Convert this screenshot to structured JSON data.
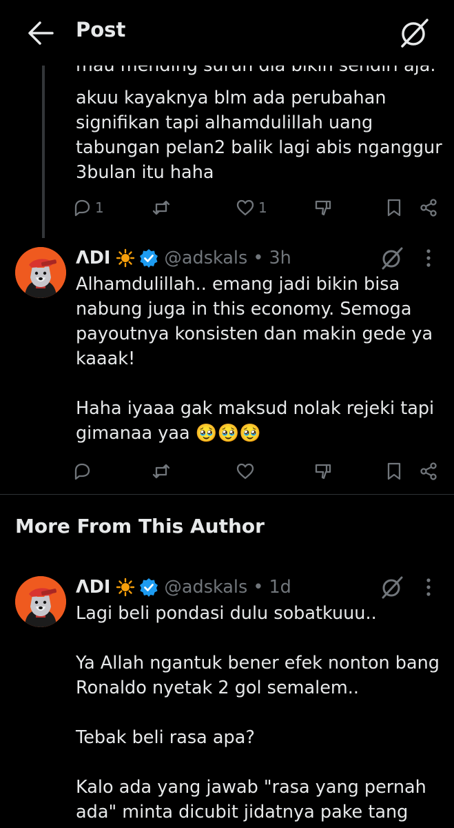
{
  "header": {
    "title": "Post"
  },
  "reply1": {
    "partial_line": "mau mending suruh dia bikin sendiri aja.",
    "text": "akuu kayaknya blm ada perubahan\nsignifikan tapi alhamdulillah uang\ntabungan pelan2 balik lagi abis nganggur\n3bulan itu haha",
    "reply_count": "1",
    "like_count": "1"
  },
  "reply2": {
    "author_name": "ΛDI",
    "handle": "@adskals",
    "time": "• 3h",
    "text": "Alhamdulillah.. emang jadi bikin bisa\nnabung juga in this economy. Semoga\npayoutnya konsisten dan makin gede ya\nkaaak!\n\nHaha iyaaa gak maksud nolak rejeki tapi\ngimanaa yaa 🥹🥹🥹"
  },
  "section": {
    "title": "More From This Author"
  },
  "post3": {
    "author_name": "ΛDI",
    "handle": "@adskals",
    "time": "• 1d",
    "text": "Lagi beli pondasi dulu sobatkuuu..\n\nYa Allah ngantuk bener efek nonton bang\nRonaldo nyetak 2 gol semalem..\n\nTebak beli rasa apa?\n\nKalo ada yang jawab \"rasa yang pernah\nada\" minta dicubit jidatnya pake tang"
  },
  "colors": {
    "background": "#000000",
    "text": "#e7e9ea",
    "muted": "#71767b",
    "verified": "#1d9bf0",
    "avatar_bg": "#ef5a1f",
    "sun": "#f59e0b"
  }
}
